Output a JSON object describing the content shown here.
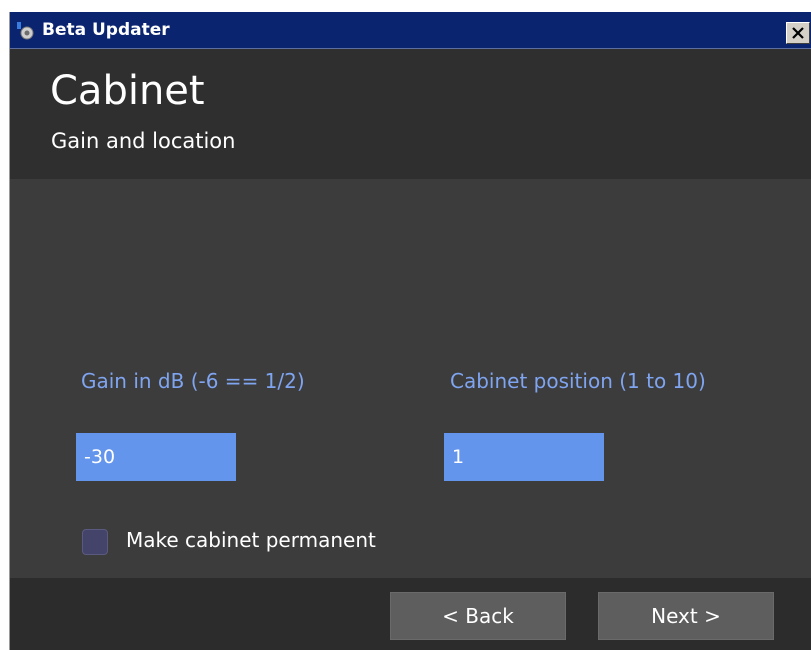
{
  "window": {
    "title": "Beta Updater"
  },
  "header": {
    "title": "Cabinet",
    "subtitle": "Gain and location"
  },
  "form": {
    "gain": {
      "label": "Gain in dB (-6 == 1/2)",
      "value": "-30"
    },
    "position": {
      "label": "Cabinet position (1 to 10)",
      "value": "1"
    },
    "permanent": {
      "label": "Make cabinet permanent",
      "checked": false
    }
  },
  "footer": {
    "back_label": "< Back",
    "next_label": "Next >"
  },
  "colors": {
    "titlebar": "#0a2470",
    "header_bg": "#2f2f2f",
    "body_bg": "#3c3c3c",
    "label_accent": "#7fa4f0",
    "input_bg": "#6495ed",
    "button_bg": "#5e5e5e"
  },
  "icons": {
    "app": "app-icon",
    "close": "close-icon",
    "checkbox": "checkbox-unchecked"
  }
}
